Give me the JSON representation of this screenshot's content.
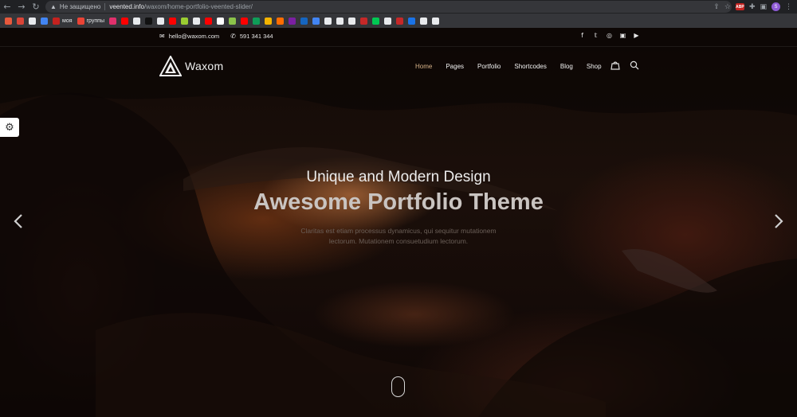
{
  "browser": {
    "security_label": "Не защищено",
    "url_host": "veented.info",
    "url_path": "/waxom/home-portfolio-veented-slider/",
    "ext_badge": "ABP",
    "profile_initial": "S",
    "bookmarks": [
      {
        "label": "",
        "color": "#e8593c"
      },
      {
        "label": "",
        "color": "#db4437"
      },
      {
        "label": "",
        "color": "#e8eaed"
      },
      {
        "label": "",
        "color": "#4285f4"
      },
      {
        "label": "моя",
        "color": "#c5221f"
      },
      {
        "label": "группы",
        "color": "#ea4335"
      },
      {
        "label": "",
        "color": "#e1306c"
      },
      {
        "label": "",
        "color": "#ff0000"
      },
      {
        "label": "",
        "color": "#e8eaed"
      },
      {
        "label": "",
        "color": "#111111"
      },
      {
        "label": "",
        "color": "#e8eaed"
      },
      {
        "label": "",
        "color": "#ff0000"
      },
      {
        "label": "",
        "color": "#9acd32"
      },
      {
        "label": "",
        "color": "#e8eaed"
      },
      {
        "label": "",
        "color": "#ff0000"
      },
      {
        "label": "",
        "color": "#ffffff"
      },
      {
        "label": "",
        "color": "#8bc34a"
      },
      {
        "label": "",
        "color": "#ff0000"
      },
      {
        "label": "",
        "color": "#0f9d58"
      },
      {
        "label": "",
        "color": "#f4b400"
      },
      {
        "label": "",
        "color": "#ff6d00"
      },
      {
        "label": "",
        "color": "#7b1fa2"
      },
      {
        "label": "",
        "color": "#1565c0"
      },
      {
        "label": "",
        "color": "#4285f4"
      },
      {
        "label": "",
        "color": "#e8eaed"
      },
      {
        "label": "",
        "color": "#e8eaed"
      },
      {
        "label": "",
        "color": "#e8eaed"
      },
      {
        "label": "",
        "color": "#c62828"
      },
      {
        "label": "",
        "color": "#00c853"
      },
      {
        "label": "",
        "color": "#e8eaed"
      },
      {
        "label": "",
        "color": "#c62828"
      },
      {
        "label": "",
        "color": "#1a73e8"
      },
      {
        "label": "",
        "color": "#e8eaed"
      },
      {
        "label": "",
        "color": "#e8eaed"
      }
    ]
  },
  "site": {
    "email": "hello@waxom.com",
    "phone": "591 341 344",
    "social_icons": [
      "facebook-icon",
      "twitter-icon",
      "dribbble-icon",
      "vimeo-icon",
      "youtube-icon"
    ],
    "logo_text": "Waxom",
    "menu": [
      "Home",
      "Pages",
      "Portfolio",
      "Shortcodes",
      "Blog",
      "Shop"
    ],
    "active_menu": "Home",
    "accent_color": "#d9b48a"
  },
  "slide": {
    "subtitle": "Unique and Modern Design",
    "title": "Awesome Portfolio Theme",
    "description_line1": "Claritas est etiam processus dynamicus, qui sequitur mutationem",
    "description_line2": "lectorum. Mutationem consuetudium lectorum."
  }
}
